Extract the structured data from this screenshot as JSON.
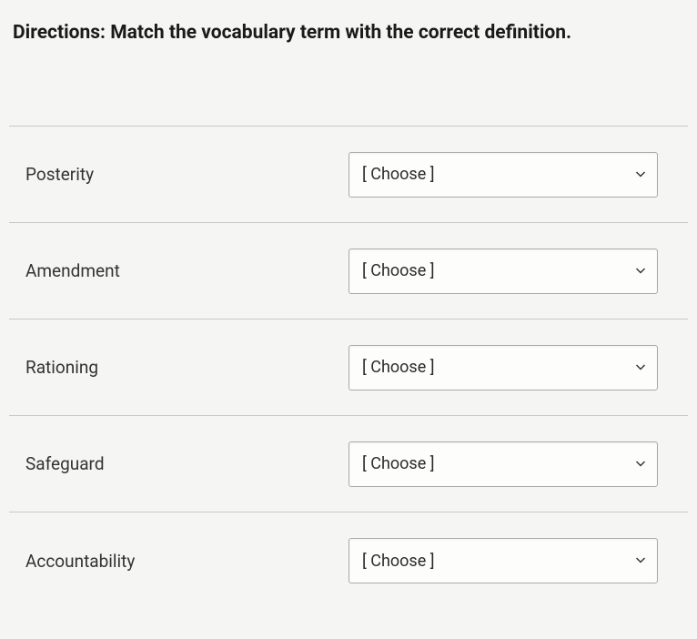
{
  "directions": "Directions: Match the vocabulary term with the correct definition.",
  "placeholder": "[ Choose ]",
  "rows": [
    {
      "term": "Posterity"
    },
    {
      "term": "Amendment"
    },
    {
      "term": "Rationing"
    },
    {
      "term": "Safeguard"
    },
    {
      "term": "Accountability"
    }
  ]
}
